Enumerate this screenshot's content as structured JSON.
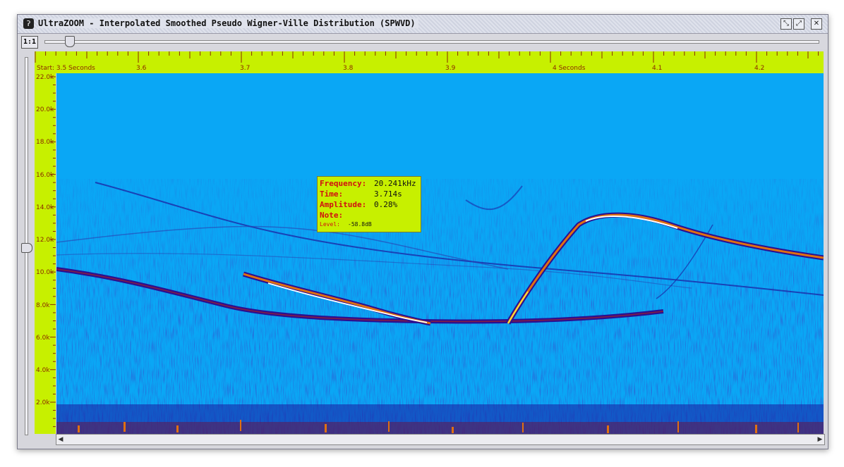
{
  "window": {
    "title": "UltraZOOM - Interpolated Smoothed Pseudo Wigner-Ville Distribution (SPWVD)",
    "app_icon": "ear-icon"
  },
  "toolbar": {
    "zoom_reset_label": "1:1"
  },
  "time_axis": {
    "ticks": [
      {
        "label": "Start: 3.5 Seconds",
        "time": 3.5
      },
      {
        "label": "3.6",
        "time": 3.6
      },
      {
        "label": "3.7",
        "time": 3.7
      },
      {
        "label": "3.8",
        "time": 3.8
      },
      {
        "label": "3.9",
        "time": 3.9
      },
      {
        "label": "4 Seconds",
        "time": 4.0
      },
      {
        "label": "4.1",
        "time": 4.1
      },
      {
        "label": "4.2",
        "time": 4.2
      }
    ]
  },
  "freq_axis": {
    "ticks": [
      "22.0k",
      "20.0k",
      "18.0k",
      "16.0k",
      "14.0k",
      "12.0k",
      "10.0k",
      "8.0k",
      "6.0k",
      "4.0k",
      "2.0k"
    ]
  },
  "tooltip": {
    "frequency_label": "Frequency:",
    "frequency_value": "20.241kHz",
    "time_label": "Time:",
    "time_value": "3.714s",
    "amplitude_label": "Amplitude:",
    "amplitude_value": "0.28%",
    "note_label": "Note:",
    "level_label": "Level:",
    "level_value": "-58.8dB"
  },
  "colors": {
    "ruler": "#c7f000",
    "background": "#0aa7f5",
    "tick_text": "#8a2a00",
    "tooltip_label": "#d01010"
  }
}
